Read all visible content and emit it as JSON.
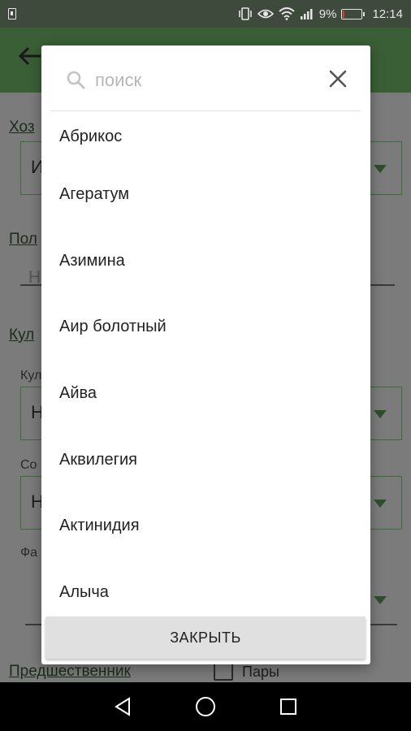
{
  "status_bar": {
    "battery_percent": "9%",
    "battery_level": 0.09,
    "time": "12:14",
    "icons": [
      "sim-icon",
      "vibrate-icon",
      "eye-icon",
      "wifi-icon",
      "signal-icon",
      "battery-icon"
    ]
  },
  "background": {
    "labels": [
      "Хоз",
      "Пол",
      "Кул",
      "Предшественник"
    ],
    "sublabels": [
      "Кул",
      "Со",
      "Фа"
    ],
    "box_chars": [
      "И",
      "Н",
      "Н"
    ],
    "field_char": "Н",
    "checkbox_label": "Пары"
  },
  "dialog": {
    "search": {
      "value": "",
      "placeholder": "поиск"
    },
    "items": [
      "Абрикос",
      "Агератум",
      "Азимина",
      "Аир болотный",
      "Айва",
      "Аквилегия",
      "Актинидия",
      "Алыча"
    ],
    "close_label": "ЗАКРЫТЬ"
  },
  "colors": {
    "accent_green": "#3a5f36",
    "dialog_bg": "#ffffff",
    "button_bg": "#e0e0e0",
    "battery_low": "#e0383a"
  }
}
